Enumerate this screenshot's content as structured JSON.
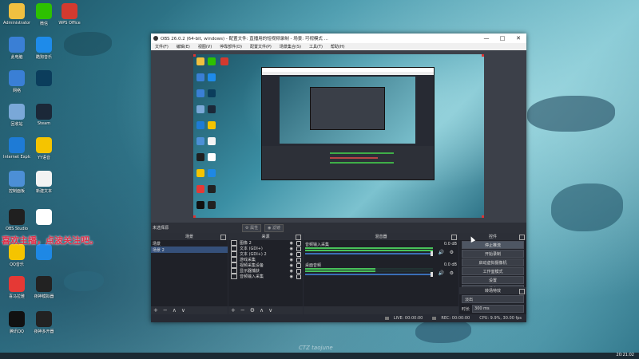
{
  "desktop": {
    "icons": [
      {
        "label": "Administrator",
        "name": "user-folder-icon",
        "color": "#f0c040"
      },
      {
        "label": "微信",
        "name": "wechat-icon",
        "color": "#2dc100"
      },
      {
        "label": "WPS Office",
        "name": "wps-office-icon",
        "color": "#d33a2f"
      },
      {
        "label": "此电脑",
        "name": "this-pc-icon",
        "color": "#3a7fd5"
      },
      {
        "label": "酷狗音乐",
        "name": "kugou-icon",
        "color": "#1e8bea"
      },
      {
        "label": "网络",
        "name": "network-icon",
        "color": "#3a7fd5"
      },
      {
        "label": "",
        "name": "app-icon",
        "color": "#0b3d5c"
      },
      {
        "label": "回收站",
        "name": "recycle-bin-icon",
        "color": "#7aa8d8"
      },
      {
        "label": "Steam",
        "name": "steam-icon",
        "color": "#1b2838"
      },
      {
        "label": "Internet Explorer",
        "name": "ie-icon",
        "color": "#1e7bd6"
      },
      {
        "label": "YY语音",
        "name": "yy-icon",
        "color": "#f5c400"
      },
      {
        "label": "控制面板",
        "name": "control-panel-icon",
        "color": "#4c8fd6"
      },
      {
        "label": "新建文本",
        "name": "text-file-icon",
        "color": "#f3f3f3"
      },
      {
        "label": "OBS Studio",
        "name": "obs-icon",
        "color": "#202020"
      },
      {
        "label": "",
        "name": "document-icon",
        "color": "#ffffff"
      },
      {
        "label": "QQ音乐",
        "name": "qq-music-icon",
        "color": "#f5c400"
      },
      {
        "label": "",
        "name": "app-e-icon",
        "color": "#1e88e5"
      },
      {
        "label": "喜马拉雅",
        "name": "ximalaya-icon",
        "color": "#e53935"
      },
      {
        "label": "夜神模拟器",
        "name": "nox-icon",
        "color": "#222222"
      },
      {
        "label": "腾讯QQ",
        "name": "qq-icon",
        "color": "#111111"
      },
      {
        "label": "夜神多开器",
        "name": "nox-multi-icon",
        "color": "#222222"
      }
    ],
    "overlay_text": "喜欢主播，点波关注吧。",
    "watermark": "CTZ taojune",
    "clock": "20:21:02"
  },
  "obs": {
    "title": "OBS 26.0.2 (64-bit, windows) - 配置文件: 直播用的短视频录制 - 场景: 可视模式 ...",
    "menu": [
      "文件(F)",
      "编辑(E)",
      "视图(V)",
      "停靠部件(D)",
      "配置文件(P)",
      "场景集合(S)",
      "工具(T)",
      "帮助(H)"
    ],
    "no_source": "未选择源",
    "prop_tabs": [
      "属性",
      "滤镜"
    ],
    "docks": {
      "scenes": {
        "title": "场景",
        "items": [
          "场景",
          "场景 2"
        ]
      },
      "sources": {
        "title": "来源",
        "items": [
          {
            "label": "图像 2",
            "icon": "image-icon"
          },
          {
            "label": "文本 (GDI+)",
            "icon": "text-icon"
          },
          {
            "label": "文本 (GDI+) 2",
            "icon": "text-icon"
          },
          {
            "label": "游戏采集",
            "icon": "game-capture-icon"
          },
          {
            "label": "视频采集设备",
            "icon": "camera-icon"
          },
          {
            "label": "显示器捕获",
            "icon": "monitor-icon"
          },
          {
            "label": "音频输入采集",
            "icon": "mic-icon"
          }
        ]
      },
      "mixer": {
        "title": "混音器",
        "channels": [
          {
            "name": "音频输入采集",
            "db": "0.0 dB",
            "level": 0.0
          },
          {
            "name": "桌面音频",
            "db": "0.0 dB",
            "level": 0.55
          }
        ]
      },
      "transitions": {
        "title": "转场特效",
        "type": "淡出",
        "duration_label": "时长",
        "duration": "300 ms"
      },
      "controls": {
        "title": "控件",
        "buttons": [
          "停止推流",
          "开始录制",
          "启动虚拟摄像机",
          "工作室模式",
          "设置",
          "退出"
        ]
      }
    },
    "status": {
      "live": "LIVE: 00:00:00",
      "rec": "REC: 00:00:00",
      "cpu": "CPU: 9.9%, 30.00 fps"
    }
  }
}
